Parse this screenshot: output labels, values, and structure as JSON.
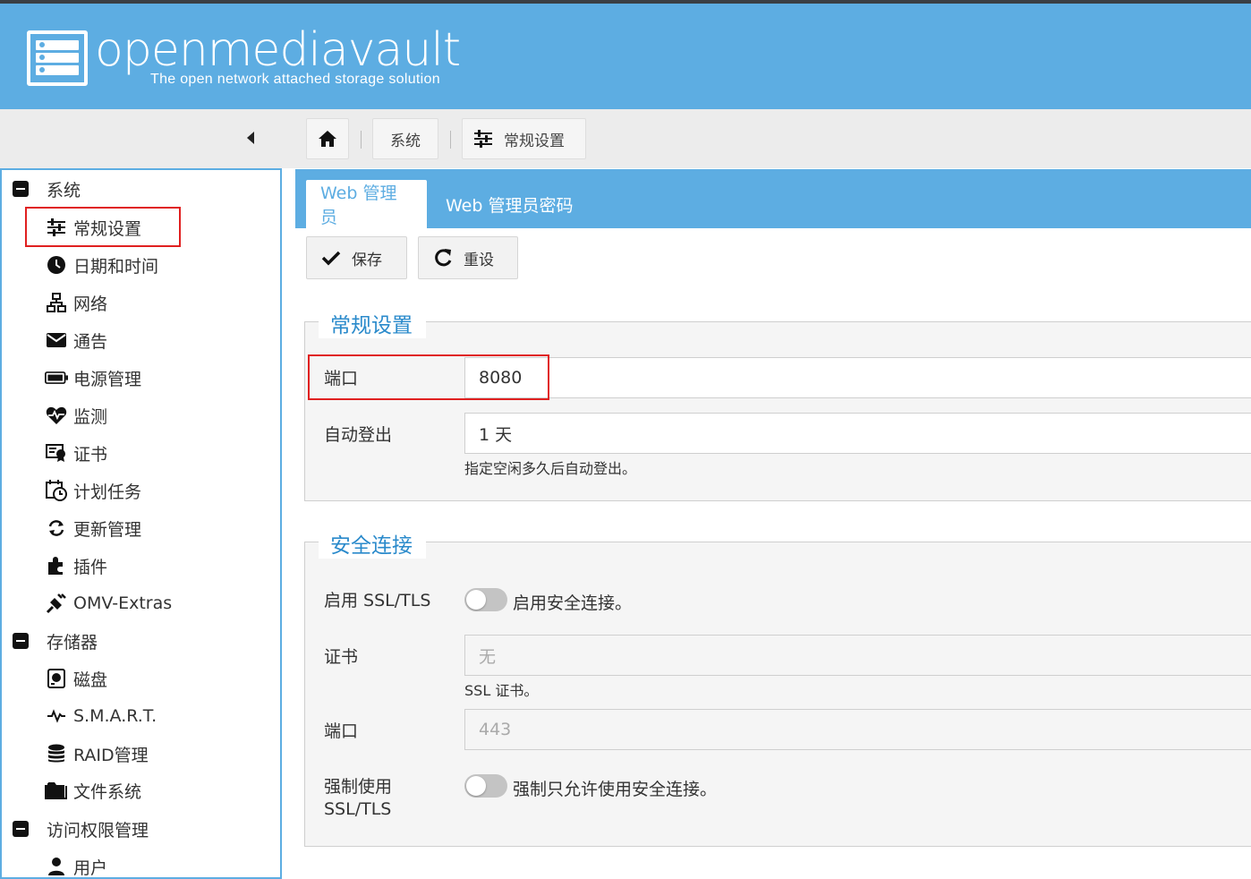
{
  "brand": {
    "name": "openmediavault",
    "tagline": "The open network attached storage solution",
    "header_color": "#5dade2"
  },
  "breadcrumb": {
    "home_icon": "home-icon",
    "items": [
      "系统",
      "常规设置"
    ]
  },
  "sidebar": {
    "groups": [
      {
        "label": "系统",
        "items": [
          {
            "label": "常规设置",
            "icon": "sliders-icon",
            "highlighted": true
          },
          {
            "label": "日期和时间",
            "icon": "clock-icon"
          },
          {
            "label": "网络",
            "icon": "network-icon"
          },
          {
            "label": "通告",
            "icon": "envelope-icon"
          },
          {
            "label": "电源管理",
            "icon": "battery-icon"
          },
          {
            "label": "监测",
            "icon": "heartbeat-icon"
          },
          {
            "label": "证书",
            "icon": "certificate-icon"
          },
          {
            "label": "计划任务",
            "icon": "calendar-clock-icon"
          },
          {
            "label": "更新管理",
            "icon": "refresh-icon"
          },
          {
            "label": "插件",
            "icon": "puzzle-icon"
          },
          {
            "label": "OMV-Extras",
            "icon": "plug-icon"
          }
        ]
      },
      {
        "label": "存储器",
        "items": [
          {
            "label": "磁盘",
            "icon": "harddisk-icon"
          },
          {
            "label": "S.M.A.R.T.",
            "icon": "pulse-icon"
          },
          {
            "label": "RAID管理",
            "icon": "database-icon"
          },
          {
            "label": "文件系统",
            "icon": "folder-icon"
          }
        ]
      },
      {
        "label": "访问权限管理",
        "items": [
          {
            "label": "用户",
            "icon": "user-icon"
          }
        ]
      }
    ]
  },
  "tabs": [
    {
      "label": "Web 管理员",
      "active": true
    },
    {
      "label": "Web 管理员密码",
      "active": false
    }
  ],
  "actions": {
    "save_label": "保存",
    "reset_label": "重设"
  },
  "general": {
    "legend": "常规设置",
    "port_label": "端口",
    "port_value": "8080",
    "autologout_label": "自动登出",
    "autologout_value": "1 天",
    "autologout_hint": "指定空闲多久后自动登出。"
  },
  "secure": {
    "legend": "安全连接",
    "ssl_label": "启用 SSL/TLS",
    "ssl_toggle_text": "启用安全连接。",
    "ssl_enabled": false,
    "cert_label": "证书",
    "cert_placeholder": "无",
    "cert_hint": "SSL 证书。",
    "port_label": "端口",
    "port_placeholder": "443",
    "force_label_line1": "强制使用",
    "force_label_line2": "SSL/TLS",
    "force_toggle_text": "强制只允许使用安全连接。",
    "force_enabled": false
  },
  "colors": {
    "accent": "#5dade2",
    "legend_text": "#2a8acb",
    "highlight_border": "#e02020"
  }
}
